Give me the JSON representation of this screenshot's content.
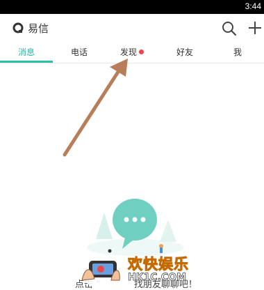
{
  "status_bar": {
    "time": "3:44"
  },
  "app_bar": {
    "title": "易信",
    "icons": [
      "logo-icon",
      "search-icon",
      "add-icon"
    ]
  },
  "tabs": [
    {
      "label": "消息",
      "active": true
    },
    {
      "label": "电话",
      "active": false
    },
    {
      "label": "发现",
      "active": false,
      "badge": "red-dot"
    },
    {
      "label": "好友",
      "active": false
    },
    {
      "label": "我",
      "active": false
    }
  ],
  "empty_state": {
    "hint_left": "点击 “",
    "hint_right": "找朋友聊聊吧！"
  },
  "watermark": {
    "title": "欢快娱乐",
    "site": "HK1C.COM"
  },
  "colors": {
    "accent": "#28c2a8",
    "badge": "#f0434c",
    "arrow": "#b87e5a"
  }
}
